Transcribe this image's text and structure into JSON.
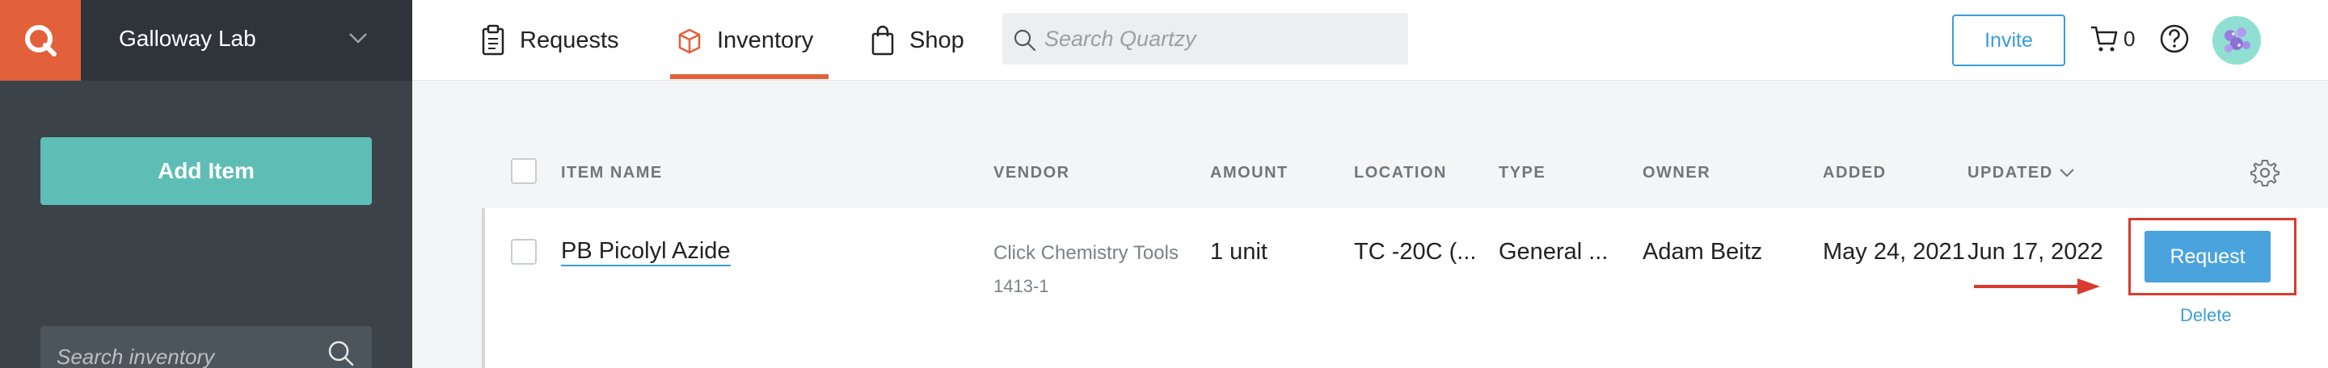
{
  "sidebar": {
    "lab_name": "Galloway Lab",
    "add_item_label": "Add Item",
    "search_placeholder": "Search inventory"
  },
  "header": {
    "nav": [
      {
        "label": "Requests",
        "icon": "clipboard-icon"
      },
      {
        "label": "Inventory",
        "icon": "box-icon",
        "active": true
      },
      {
        "label": "Shop",
        "icon": "shopping-bag-icon"
      }
    ],
    "search_placeholder": "Search Quartzy",
    "invite_label": "Invite",
    "cart_count": "0"
  },
  "table": {
    "columns": [
      "ITEM NAME",
      "VENDOR",
      "AMOUNT",
      "LOCATION",
      "TYPE",
      "OWNER",
      "ADDED",
      "UPDATED"
    ],
    "rows": [
      {
        "item_name": "PB Picolyl Azide",
        "vendor": "Click Chemistry Tools",
        "catalog": "1413-1",
        "amount": "1 unit",
        "location": "TC -20C (...",
        "type": "General ...",
        "owner": "Adam Beitz",
        "added": "May 24, 2021",
        "updated": "Jun 17, 2022",
        "request_label": "Request",
        "delete_label": "Delete"
      }
    ]
  },
  "colors": {
    "brand_orange": "#e2603a",
    "sidebar_bg": "#3b4248",
    "teal": "#5ebdb5",
    "blue": "#4aa3dc",
    "highlight_red": "#d93b2f"
  }
}
